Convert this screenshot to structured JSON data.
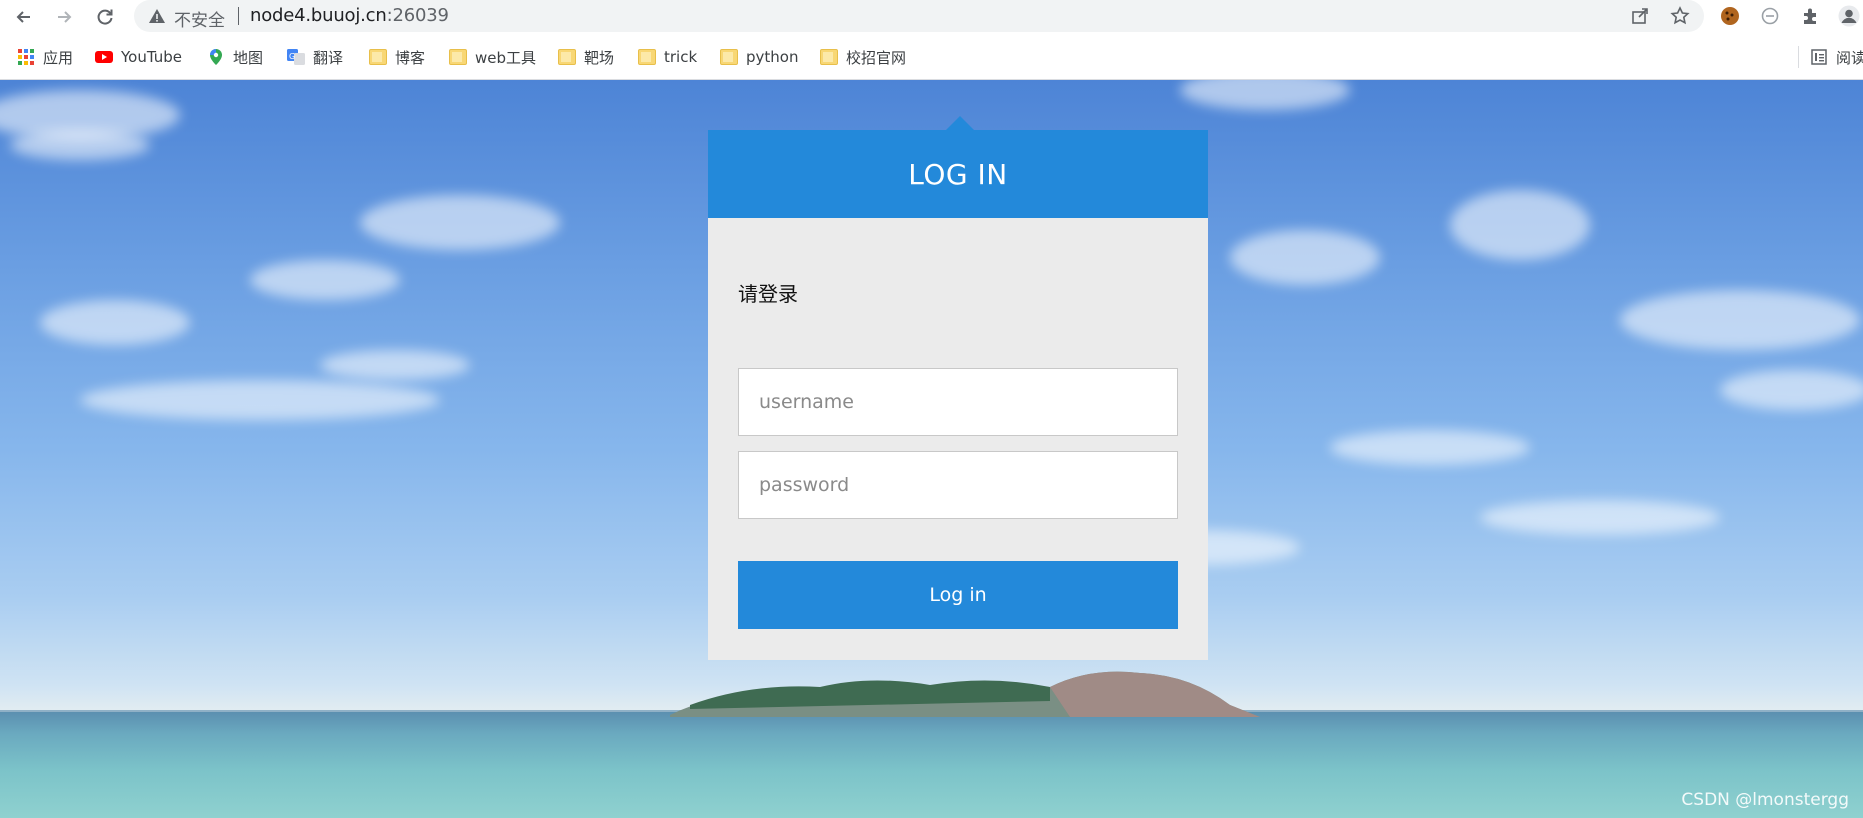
{
  "browser": {
    "security_label": "不安全",
    "url_host": "node4.buuoj.cn",
    "url_port": ":26039"
  },
  "bookmarks": [
    {
      "label": "应用",
      "icon": "apps-grid-icon"
    },
    {
      "label": "YouTube",
      "icon": "youtube-icon"
    },
    {
      "label": "地图",
      "icon": "maps-pin-icon"
    },
    {
      "label": "翻译",
      "icon": "translate-icon"
    },
    {
      "label": "博客",
      "icon": "folder-icon"
    },
    {
      "label": "web工具",
      "icon": "folder-icon"
    },
    {
      "label": "靶场",
      "icon": "folder-icon"
    },
    {
      "label": "trick",
      "icon": "folder-icon"
    },
    {
      "label": "python",
      "icon": "folder-icon"
    },
    {
      "label": "校招官网",
      "icon": "folder-icon"
    }
  ],
  "reading_list_label": "阅读",
  "login": {
    "title": "LOG IN",
    "prompt": "请登录",
    "username_placeholder": "username",
    "password_placeholder": "password",
    "button_label": "Log in"
  },
  "watermark": "CSDN @lmonstergg",
  "colors": {
    "accent": "#2389da",
    "card_body": "#ebebeb"
  }
}
